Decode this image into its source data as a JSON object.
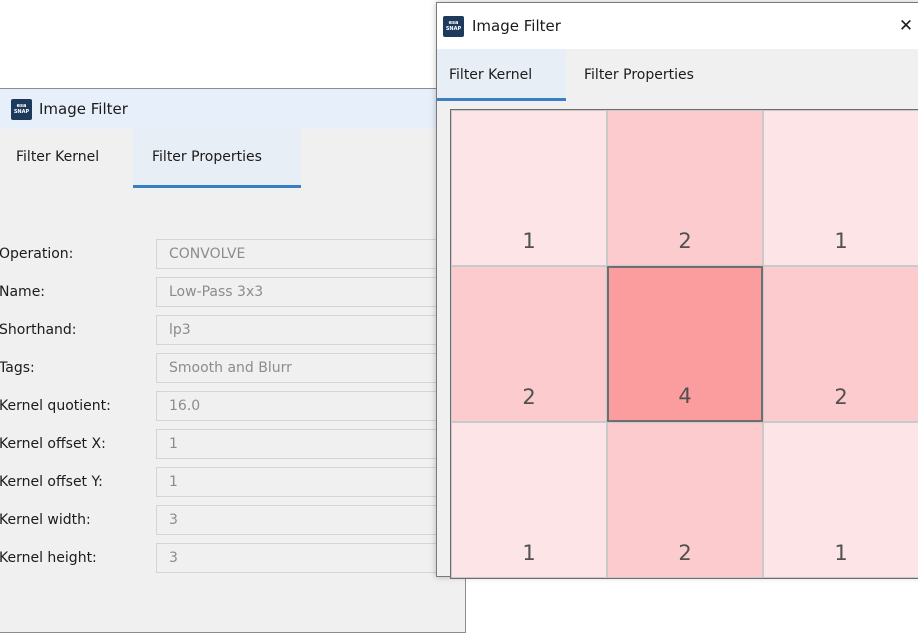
{
  "back_window": {
    "title": "Image Filter",
    "icon_text": [
      "esa",
      "SNAP"
    ],
    "tabs": [
      "Filter Kernel",
      "Filter Properties"
    ],
    "active_tab": "Filter Properties",
    "properties": [
      {
        "label": "Operation:",
        "value": "CONVOLVE"
      },
      {
        "label": "Name:",
        "value": "Low-Pass 3x3"
      },
      {
        "label": "Shorthand:",
        "value": "lp3"
      },
      {
        "label": "Tags:",
        "value": "Smooth and Blurr"
      },
      {
        "label": "Kernel quotient:",
        "value": "16.0"
      },
      {
        "label": "Kernel offset X:",
        "value": "1"
      },
      {
        "label": "Kernel offset Y:",
        "value": "1"
      },
      {
        "label": "Kernel width:",
        "value": "3"
      },
      {
        "label": "Kernel height:",
        "value": "3"
      }
    ]
  },
  "front_window": {
    "title": "Image Filter",
    "icon_text": [
      "esa",
      "SNAP"
    ],
    "close_icon": "close-icon",
    "close_glyph": "✕",
    "tabs": [
      "Filter Kernel",
      "Filter Properties"
    ],
    "active_tab": "Filter Kernel",
    "kernel": {
      "rows": 3,
      "cols": 3,
      "values": [
        [
          "1",
          "2",
          "1"
        ],
        [
          "2",
          "4",
          "2"
        ],
        [
          "1",
          "2",
          "1"
        ]
      ],
      "selected": [
        1,
        1
      ]
    }
  },
  "colors": {
    "tab_underline": "#3a7fc3",
    "cell_weight_1": "#fde4e6",
    "cell_weight_2": "#fccbce",
    "cell_weight_4": "#fb9c9e",
    "field_text": "#8c8c8c"
  }
}
